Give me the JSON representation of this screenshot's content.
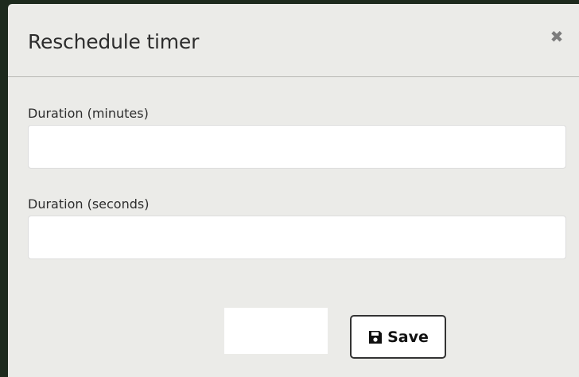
{
  "dialog": {
    "title": "Reschedule timer",
    "close_icon": "close-icon"
  },
  "fields": {
    "minutes": {
      "label": "Duration (minutes)",
      "value": "",
      "placeholder": ""
    },
    "seconds": {
      "label": "Duration (seconds)",
      "value": "",
      "placeholder": ""
    }
  },
  "footer": {
    "save_label": "Save",
    "save_icon": "floppy-disk-icon"
  },
  "colors": {
    "modal_background": "#ebebe8",
    "text": "#2d2d2d",
    "button_border": "#333333"
  }
}
